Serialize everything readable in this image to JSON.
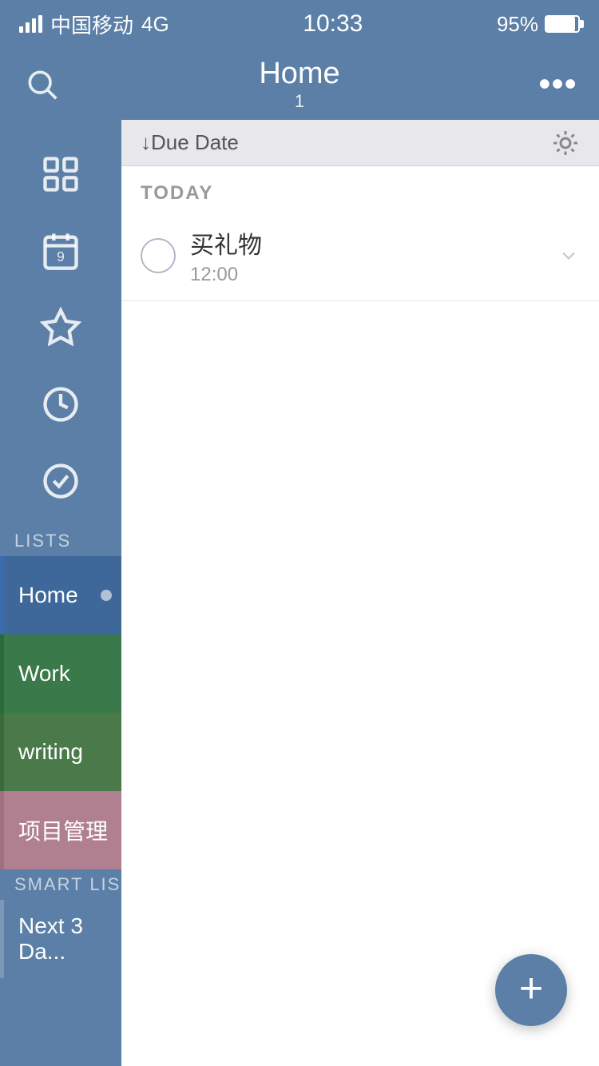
{
  "status": {
    "carrier": "中国移动",
    "network": "4G",
    "time": "10:33",
    "battery": "95%"
  },
  "nav": {
    "title": "Home",
    "badge": "1",
    "more_icon": "more-horizontal-icon",
    "search_icon": "search-icon"
  },
  "sort_bar": {
    "label": "↓Due Date",
    "sun_icon": "sun-icon"
  },
  "sections": [
    {
      "title": "TODAY",
      "tasks": [
        {
          "name": "买礼物",
          "time": "12:00"
        }
      ]
    }
  ],
  "sidebar": {
    "icons": [
      {
        "name": "grid-icon",
        "label": "Grid"
      },
      {
        "name": "calendar-icon",
        "label": "Calendar"
      },
      {
        "name": "star-icon",
        "label": "Starred"
      },
      {
        "name": "clock-icon",
        "label": "Scheduled"
      },
      {
        "name": "check-circle-icon",
        "label": "Done"
      }
    ],
    "lists_label": "LISTS",
    "lists": [
      {
        "id": "home",
        "label": "Home",
        "active": true,
        "color": "list-home"
      },
      {
        "id": "work",
        "label": "Work",
        "active": false,
        "color": "list-work"
      },
      {
        "id": "writing",
        "label": "writing",
        "active": false,
        "color": "list-writing"
      },
      {
        "id": "project",
        "label": "项目管理",
        "active": false,
        "color": "list-project"
      }
    ],
    "smart_lists_label": "SMART LIS",
    "smart_lists": [
      {
        "id": "next3days",
        "label": "Next 3 Da...",
        "active": false,
        "color": "list-next3"
      }
    ]
  },
  "fab": {
    "label": "+"
  }
}
